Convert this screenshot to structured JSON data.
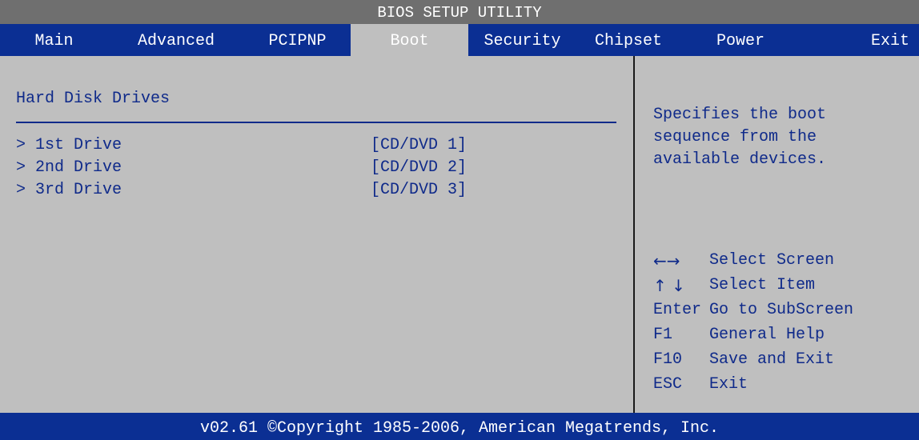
{
  "title": "BIOS SETUP UTILITY",
  "menu": [
    {
      "label": "Main"
    },
    {
      "label": "Advanced"
    },
    {
      "label": "PCIPNP"
    },
    {
      "label": "Boot"
    },
    {
      "label": "Security"
    },
    {
      "label": "Chipset"
    },
    {
      "label": "Power"
    },
    {
      "label": "Exit"
    }
  ],
  "active_menu": "Boot",
  "section": {
    "title": "Hard Disk Drives"
  },
  "drives": [
    {
      "label": "> 1st Drive",
      "value": "[CD/DVD 1]"
    },
    {
      "label": "> 2nd Drive",
      "value": "[CD/DVD 2]"
    },
    {
      "label": "> 3rd Drive",
      "value": "[CD/DVD 3]"
    }
  ],
  "help": {
    "lines": [
      "Specifies the boot",
      "sequence from the",
      "available devices."
    ]
  },
  "keys": [
    {
      "key": "←→",
      "desc": "Select Screen",
      "icon": "left-right-arrow-icon"
    },
    {
      "key": "↑ ↓",
      "desc": "Select Item",
      "icon": "up-down-arrow-icon"
    },
    {
      "key": "Enter",
      "desc": "Go to SubScreen"
    },
    {
      "key": "F1",
      "desc": "General Help"
    },
    {
      "key": "F10",
      "desc": "Save and Exit"
    },
    {
      "key": "ESC",
      "desc": "Exit"
    }
  ],
  "footer": "v02.61 ©Copyright 1985-2006, American Megatrends, Inc.",
  "colors": {
    "background": "#bfbfbf",
    "title_bar": "#6f6f6f",
    "menu_bar": "#0b2f93",
    "text": "#0f2a8a",
    "active_tab_text": "#ffffff"
  }
}
